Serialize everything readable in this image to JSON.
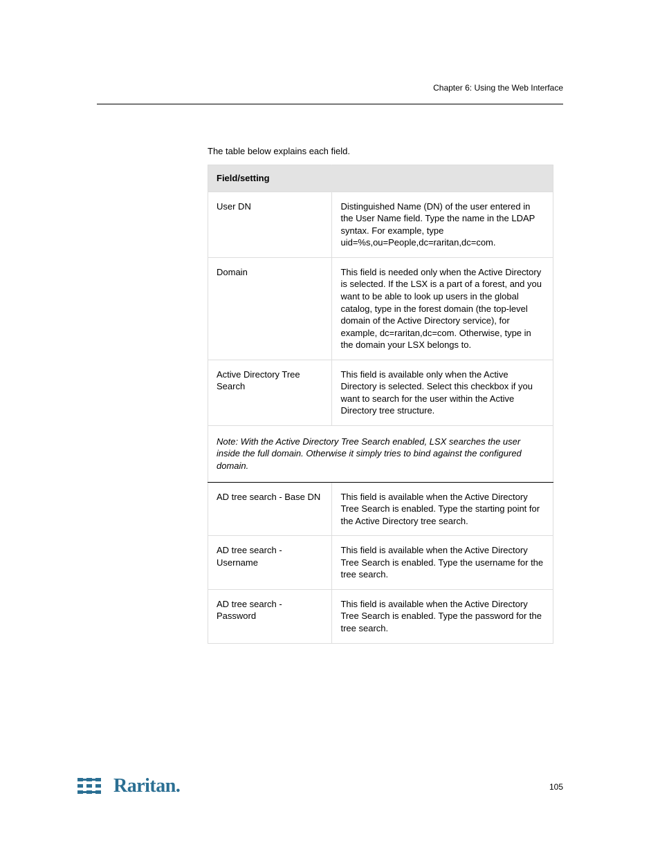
{
  "header": {
    "chapter_line": "Chapter 6: Using the Web Interface"
  },
  "intro": {
    "para1": "The table below explains each field.",
    "table_header": "Field/setting",
    "col2_header": " ",
    "rows": [
      {
        "field": "User DN",
        "desc": "Distinguished Name (DN) of the user entered in the User Name field. Type the name in the LDAP syntax. For example, type uid=%s,ou=People,dc=raritan,dc=com."
      },
      {
        "field": "Domain",
        "desc": "This field is needed only when the Active Directory is selected. If the LSX is a part of a forest, and you want to be able to look up users in the global catalog, type in the forest domain (the top-level domain of the Active Directory service), for example, dc=raritan,dc=com. Otherwise, type in the domain your LSX belongs to."
      },
      {
        "field": "Active Directory Tree Search",
        "desc": "This field is available only when the Active Directory is selected. Select this checkbox if you want to search for the user within the Active Directory tree structure."
      }
    ],
    "note": "Note: With  the Active Directory Tree Search enabled, LSX searches the user inside the full domain. Otherwise it simply tries to bind against the configured domain.",
    "rows2": [
      {
        "field": "AD tree search - Base DN",
        "desc": "This field is available when the Active Directory Tree Search is enabled. Type the starting point for the Active Directory tree search."
      },
      {
        "field": "AD tree search - Username",
        "desc": "This field is available when the Active Directory Tree Search is enabled. Type the username for the tree search."
      },
      {
        "field": "AD tree search - Password",
        "desc": "This field is available when the Active Directory Tree Search is enabled. Type the password for the tree search."
      }
    ]
  },
  "footer": {
    "logo_word": "Raritan.",
    "page_number": "105"
  }
}
